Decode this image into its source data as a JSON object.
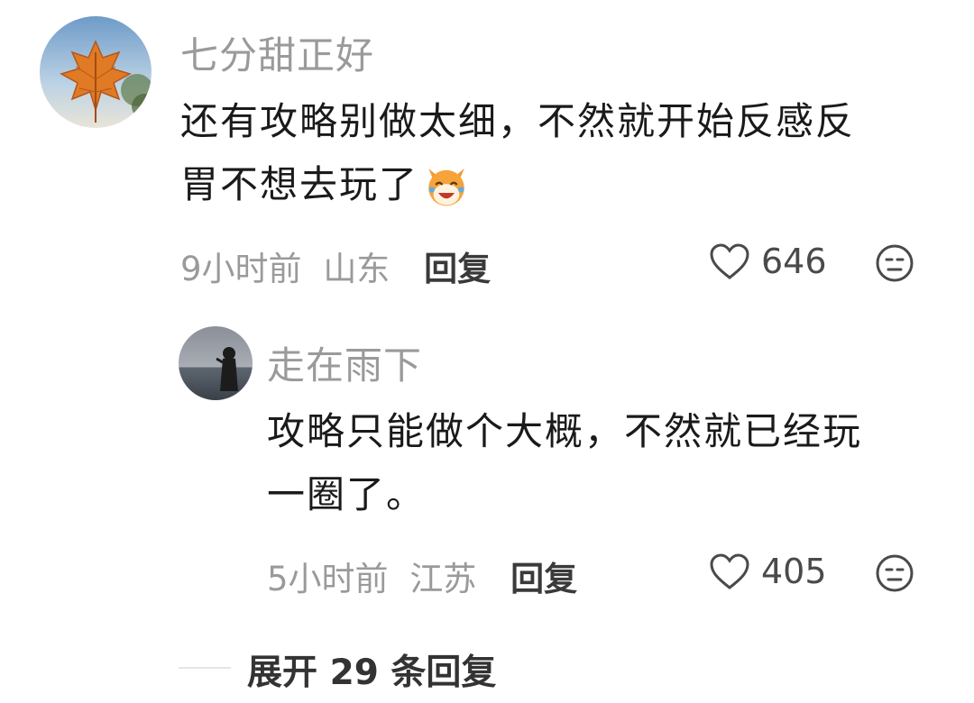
{
  "comments": [
    {
      "username": "七分甜正好",
      "text_line1": "还有攻略别做太细，不然就开始反感反",
      "text_line2": "胃不想去玩了",
      "emoji_icon": "laughing-cat-emoji",
      "time": "9小时前",
      "location": "山东",
      "reply_label": "回复",
      "likes": "646"
    },
    {
      "username": "走在雨下",
      "text_line1": "攻略只能做个大概，不然就已经玩",
      "text_line2": "一圈了。",
      "time": "5小时前",
      "location": "江苏",
      "reply_label": "回复",
      "likes": "405"
    }
  ],
  "expand_replies": "展开 29 条回复",
  "colors": {
    "username": "#9a9a9a",
    "meta": "#9a9a9a",
    "text": "#1a1a1a"
  }
}
